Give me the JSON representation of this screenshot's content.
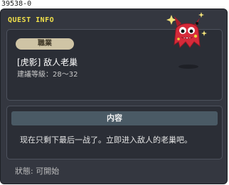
{
  "header": {
    "quest_id": "39538-0",
    "title": "QUEST INFO"
  },
  "quest": {
    "job_badge": "職業",
    "name": "[虎影] 敌人老巢",
    "level_label": "建議等級：28～32"
  },
  "content": {
    "header": "内容",
    "text": "现在只剩下最后一战了。立即进入敌人的老巢吧。"
  },
  "status": {
    "text": "狀態: 可開始"
  },
  "colors": {
    "title": "#f0e04a",
    "npc": "#d62a3a",
    "badge": "#cfc4a5"
  },
  "icons": {
    "npc": "red-demon-npc-icon"
  }
}
